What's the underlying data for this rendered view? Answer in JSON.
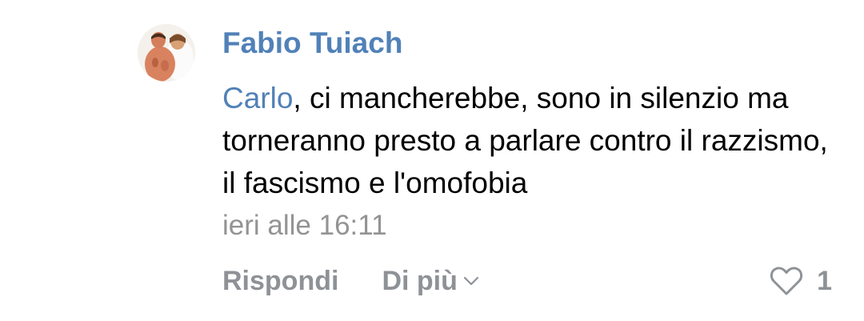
{
  "comment": {
    "author": "Fabio Tuiach",
    "mention": "Carlo",
    "text": ", ci mancherebbe, sono in silenzio ma torneranno presto a parlare contro il razzismo, il fascismo e l'omofobia",
    "time": "ieri alle 16:11"
  },
  "actions": {
    "reply_label": "Rispondi",
    "more_label": "Di più",
    "like_count": "1"
  },
  "colors": {
    "link": "#5181b8",
    "muted": "#8e9297"
  },
  "icons": {
    "avatar": "user-photo",
    "more": "chevron-down-icon",
    "like": "heart-icon"
  }
}
